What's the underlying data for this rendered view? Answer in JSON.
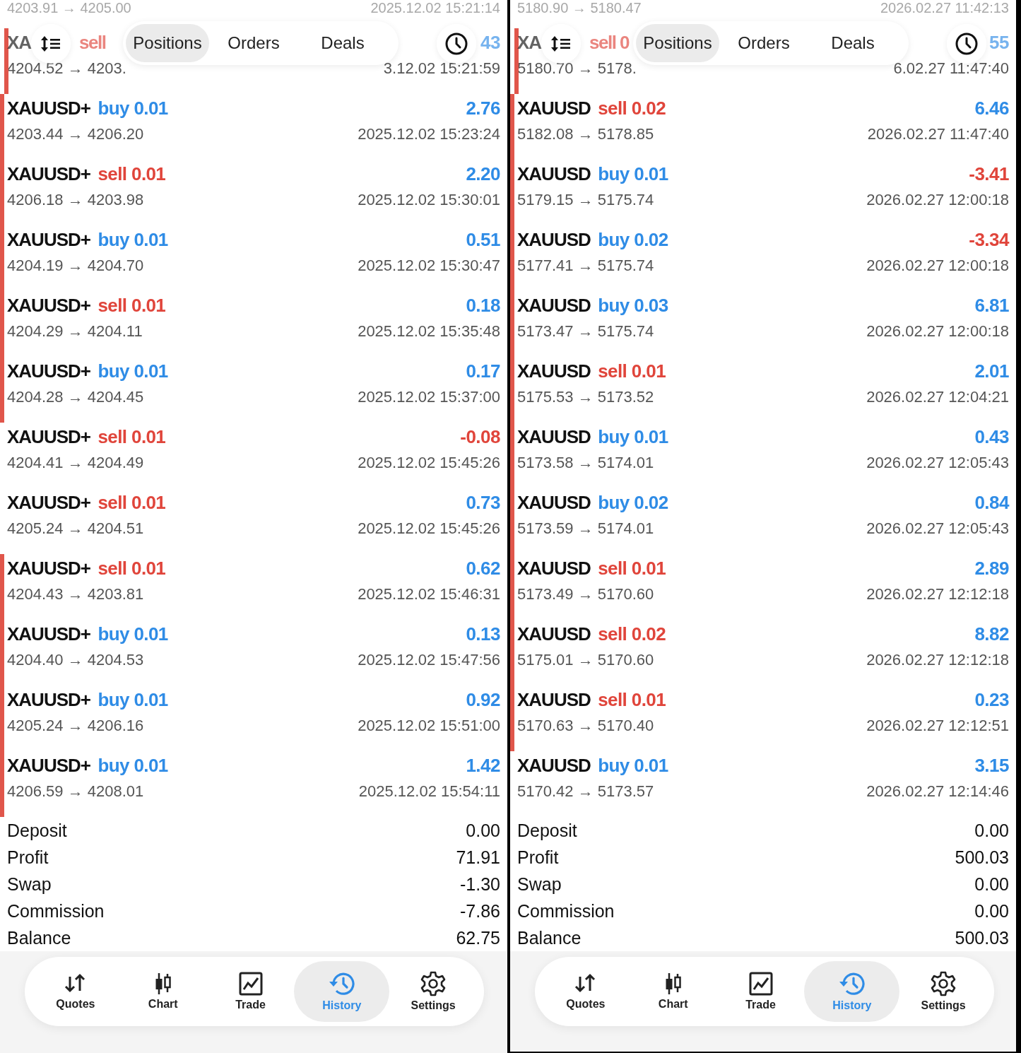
{
  "panels": [
    {
      "peek_top": {
        "prices": "4203.91 → 4205.00",
        "time": "2025.12.02 15:21:14"
      },
      "peek_row": {
        "symbol": "XA",
        "side": "sell",
        "kind": "sell",
        "profit": "43",
        "prices": "4204.52 → 4203.",
        "time": "3.12.02 15:21:59",
        "marked": true
      },
      "tabs": [
        {
          "label": "Positions",
          "selected": true
        },
        {
          "label": "Orders",
          "selected": false
        },
        {
          "label": "Deals",
          "selected": false
        }
      ],
      "deals": [
        {
          "symbol": "XAUUSD+",
          "side": "buy 0.01",
          "kind": "buy",
          "profit": "2.76",
          "loss": false,
          "prices": "4203.44 → 4206.20",
          "time": "2025.12.02 15:23:24",
          "marked": true
        },
        {
          "symbol": "XAUUSD+",
          "side": "sell 0.01",
          "kind": "sell",
          "profit": "2.20",
          "loss": false,
          "prices": "4206.18 → 4203.98",
          "time": "2025.12.02 15:30:01",
          "marked": true
        },
        {
          "symbol": "XAUUSD+",
          "side": "buy 0.01",
          "kind": "buy",
          "profit": "0.51",
          "loss": false,
          "prices": "4204.19 → 4204.70",
          "time": "2025.12.02 15:30:47",
          "marked": true
        },
        {
          "symbol": "XAUUSD+",
          "side": "sell 0.01",
          "kind": "sell",
          "profit": "0.18",
          "loss": false,
          "prices": "4204.29 → 4204.11",
          "time": "2025.12.02 15:35:48",
          "marked": true
        },
        {
          "symbol": "XAUUSD+",
          "side": "buy 0.01",
          "kind": "buy",
          "profit": "0.17",
          "loss": false,
          "prices": "4204.28 → 4204.45",
          "time": "2025.12.02 15:37:00",
          "marked": true
        },
        {
          "symbol": "XAUUSD+",
          "side": "sell 0.01",
          "kind": "sell",
          "profit": "-0.08",
          "loss": true,
          "prices": "4204.41 → 4204.49",
          "time": "2025.12.02 15:45:26",
          "marked": false
        },
        {
          "symbol": "XAUUSD+",
          "side": "sell 0.01",
          "kind": "sell",
          "profit": "0.73",
          "loss": false,
          "prices": "4205.24 → 4204.51",
          "time": "2025.12.02 15:45:26",
          "marked": false
        },
        {
          "symbol": "XAUUSD+",
          "side": "sell 0.01",
          "kind": "sell",
          "profit": "0.62",
          "loss": false,
          "prices": "4204.43 → 4203.81",
          "time": "2025.12.02 15:46:31",
          "marked": true
        },
        {
          "symbol": "XAUUSD+",
          "side": "buy 0.01",
          "kind": "buy",
          "profit": "0.13",
          "loss": false,
          "prices": "4204.40 → 4204.53",
          "time": "2025.12.02 15:47:56",
          "marked": true
        },
        {
          "symbol": "XAUUSD+",
          "side": "buy 0.01",
          "kind": "buy",
          "profit": "0.92",
          "loss": false,
          "prices": "4205.24 → 4206.16",
          "time": "2025.12.02 15:51:00",
          "marked": true
        },
        {
          "symbol": "XAUUSD+",
          "side": "buy 0.01",
          "kind": "buy",
          "profit": "1.42",
          "loss": false,
          "prices": "4206.59 → 4208.01",
          "time": "2025.12.02 15:54:11",
          "marked": true
        }
      ],
      "summary": [
        {
          "label": "Deposit",
          "value": "0.00"
        },
        {
          "label": "Profit",
          "value": "71.91"
        },
        {
          "label": "Swap",
          "value": "-1.30"
        },
        {
          "label": "Commission",
          "value": "-7.86"
        },
        {
          "label": "Balance",
          "value": "62.75"
        }
      ],
      "nav": [
        {
          "label": "Quotes",
          "kind": "quotes",
          "selected": false
        },
        {
          "label": "Chart",
          "kind": "chart",
          "selected": false
        },
        {
          "label": "Trade",
          "kind": "trade",
          "selected": false
        },
        {
          "label": "History",
          "kind": "history",
          "selected": true
        },
        {
          "label": "Settings",
          "kind": "settings",
          "selected": false
        }
      ]
    },
    {
      "peek_top": {
        "prices": "5180.90 → 5180.47",
        "time": "2026.02.27 11:42:13"
      },
      "peek_row": {
        "symbol": "XA",
        "side": "sell 0",
        "kind": "sell",
        "profit": "55",
        "prices": "5180.70 → 5178.",
        "time": "6.02.27 11:47:40",
        "marked": true
      },
      "tabs": [
        {
          "label": "Positions",
          "selected": true
        },
        {
          "label": "Orders",
          "selected": false
        },
        {
          "label": "Deals",
          "selected": false
        }
      ],
      "deals": [
        {
          "symbol": "XAUUSD",
          "side": "sell 0.02",
          "kind": "sell",
          "profit": "6.46",
          "loss": false,
          "prices": "5182.08 → 5178.85",
          "time": "2026.02.27 11:47:40",
          "marked": true
        },
        {
          "symbol": "XAUUSD",
          "side": "buy 0.01",
          "kind": "buy",
          "profit": "-3.41",
          "loss": true,
          "prices": "5179.15 → 5175.74",
          "time": "2026.02.27 12:00:18",
          "marked": true
        },
        {
          "symbol": "XAUUSD",
          "side": "buy 0.02",
          "kind": "buy",
          "profit": "-3.34",
          "loss": true,
          "prices": "5177.41 → 5175.74",
          "time": "2026.02.27 12:00:18",
          "marked": true
        },
        {
          "symbol": "XAUUSD",
          "side": "buy 0.03",
          "kind": "buy",
          "profit": "6.81",
          "loss": false,
          "prices": "5173.47 → 5175.74",
          "time": "2026.02.27 12:00:18",
          "marked": true
        },
        {
          "symbol": "XAUUSD",
          "side": "sell 0.01",
          "kind": "sell",
          "profit": "2.01",
          "loss": false,
          "prices": "5175.53 → 5173.52",
          "time": "2026.02.27 12:04:21",
          "marked": true
        },
        {
          "symbol": "XAUUSD",
          "side": "buy 0.01",
          "kind": "buy",
          "profit": "0.43",
          "loss": false,
          "prices": "5173.58 → 5174.01",
          "time": "2026.02.27 12:05:43",
          "marked": true
        },
        {
          "symbol": "XAUUSD",
          "side": "buy 0.02",
          "kind": "buy",
          "profit": "0.84",
          "loss": false,
          "prices": "5173.59 → 5174.01",
          "time": "2026.02.27 12:05:43",
          "marked": true
        },
        {
          "symbol": "XAUUSD",
          "side": "sell 0.01",
          "kind": "sell",
          "profit": "2.89",
          "loss": false,
          "prices": "5173.49 → 5170.60",
          "time": "2026.02.27 12:12:18",
          "marked": true
        },
        {
          "symbol": "XAUUSD",
          "side": "sell 0.02",
          "kind": "sell",
          "profit": "8.82",
          "loss": false,
          "prices": "5175.01 → 5170.60",
          "time": "2026.02.27 12:12:18",
          "marked": true
        },
        {
          "symbol": "XAUUSD",
          "side": "sell 0.01",
          "kind": "sell",
          "profit": "0.23",
          "loss": false,
          "prices": "5170.63 → 5170.40",
          "time": "2026.02.27 12:12:51",
          "marked": true
        },
        {
          "symbol": "XAUUSD",
          "side": "buy 0.01",
          "kind": "buy",
          "profit": "3.15",
          "loss": false,
          "prices": "5170.42 → 5173.57",
          "time": "2026.02.27 12:14:46",
          "marked": false
        }
      ],
      "summary": [
        {
          "label": "Deposit",
          "value": "0.00"
        },
        {
          "label": "Profit",
          "value": "500.03"
        },
        {
          "label": "Swap",
          "value": "0.00"
        },
        {
          "label": "Commission",
          "value": "0.00"
        },
        {
          "label": "Balance",
          "value": "500.03"
        }
      ],
      "nav": [
        {
          "label": "Quotes",
          "kind": "quotes",
          "selected": false
        },
        {
          "label": "Chart",
          "kind": "chart",
          "selected": false
        },
        {
          "label": "Trade",
          "kind": "trade",
          "selected": false
        },
        {
          "label": "History",
          "kind": "history",
          "selected": true
        },
        {
          "label": "Settings",
          "kind": "settings",
          "selected": false
        }
      ]
    }
  ]
}
